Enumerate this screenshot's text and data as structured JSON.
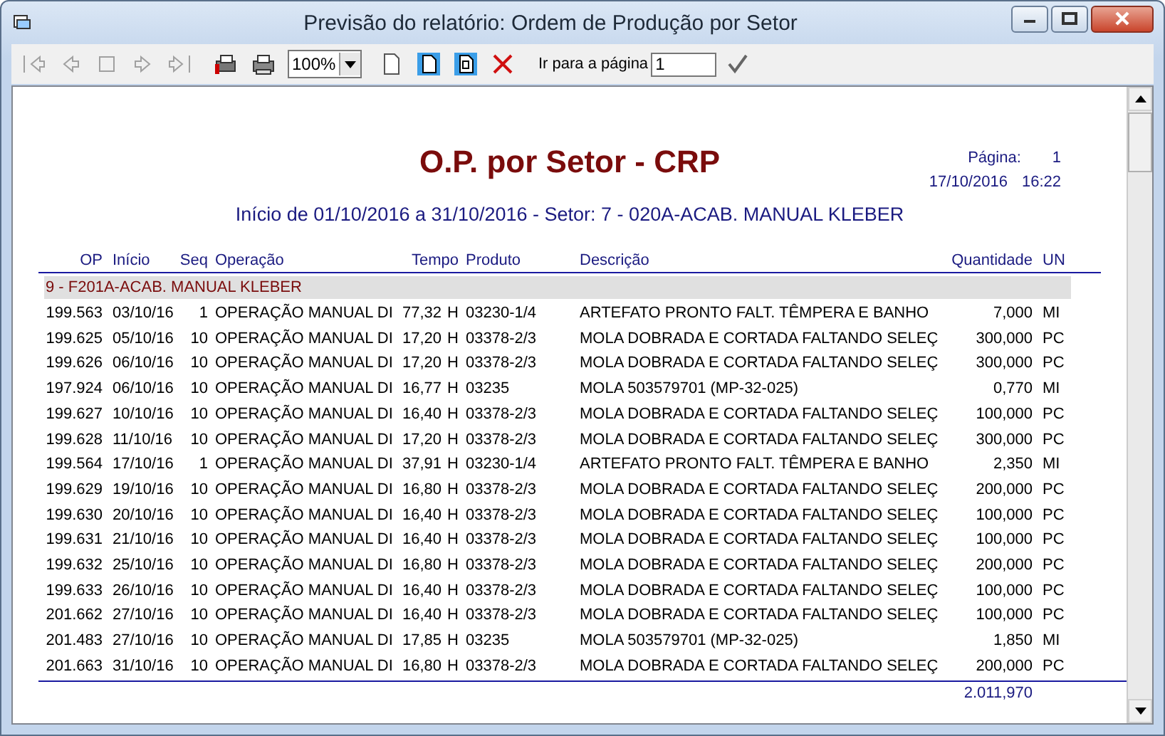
{
  "window": {
    "title": "Previsão do relatório: Ordem de Produção por Setor"
  },
  "toolbar": {
    "buttons": [
      {
        "kind": "first",
        "disabled": true
      },
      {
        "kind": "prev",
        "disabled": true
      },
      {
        "kind": "stop",
        "disabled": true
      },
      {
        "kind": "next",
        "disabled": true
      },
      {
        "kind": "last",
        "disabled": true
      }
    ],
    "print_buttons": [
      {
        "kind": "print-setup"
      },
      {
        "kind": "print"
      }
    ],
    "zoom": {
      "value": "100%"
    },
    "page_buttons": [
      {
        "kind": "page"
      },
      {
        "kind": "page-width"
      },
      {
        "kind": "full-page"
      },
      {
        "kind": "close"
      }
    ],
    "goto": {
      "label": "Ir para a página",
      "value": "1"
    }
  },
  "report": {
    "title": "O.P. por Setor - CRP",
    "subtitle": "Início de 01/10/2016 a 31/10/2016 - Setor: 7 - 020A-ACAB. MANUAL KLEBER",
    "page_label": "Página:",
    "page_number": "1",
    "date": "17/10/2016",
    "time": "16:22",
    "columns": [
      "OP",
      "Início",
      "Seq",
      "Operação",
      "Tempo",
      "",
      "Produto",
      "Descrição",
      "Quantidade",
      "UN"
    ],
    "group": "9 - F201A-ACAB. MANUAL KLEBER",
    "rows": [
      [
        "199.563",
        "03/10/16",
        "1",
        "OPERAÇÃO MANUAL DI",
        "77,32",
        "H",
        "03230-1/4",
        "ARTEFATO PRONTO FALT. TÊMPERA E BANHO",
        "7,000",
        "MI"
      ],
      [
        "199.625",
        "05/10/16",
        "10",
        "OPERAÇÃO MANUAL DI",
        "17,20",
        "H",
        "03378-2/3",
        "MOLA DOBRADA E CORTADA FALTANDO SELEÇ",
        "300,000",
        "PC"
      ],
      [
        "199.626",
        "06/10/16",
        "10",
        "OPERAÇÃO MANUAL DI",
        "17,20",
        "H",
        "03378-2/3",
        "MOLA DOBRADA E CORTADA FALTANDO SELEÇ",
        "300,000",
        "PC"
      ],
      [
        "197.924",
        "06/10/16",
        "10",
        "OPERAÇÃO MANUAL DI",
        "16,77",
        "H",
        "03235",
        "MOLA 503579701 (MP-32-025)",
        "0,770",
        "MI"
      ],
      [
        "199.627",
        "10/10/16",
        "10",
        "OPERAÇÃO MANUAL DI",
        "16,40",
        "H",
        "03378-2/3",
        "MOLA DOBRADA E CORTADA FALTANDO SELEÇ",
        "100,000",
        "PC"
      ],
      [
        "199.628",
        "11/10/16",
        "10",
        "OPERAÇÃO MANUAL DI",
        "17,20",
        "H",
        "03378-2/3",
        "MOLA DOBRADA E CORTADA FALTANDO SELEÇ",
        "300,000",
        "PC"
      ],
      [
        "199.564",
        "17/10/16",
        "1",
        "OPERAÇÃO MANUAL DI",
        "37,91",
        "H",
        "03230-1/4",
        "ARTEFATO PRONTO FALT. TÊMPERA E BANHO",
        "2,350",
        "MI"
      ],
      [
        "199.629",
        "19/10/16",
        "10",
        "OPERAÇÃO MANUAL DI",
        "16,80",
        "H",
        "03378-2/3",
        "MOLA DOBRADA E CORTADA FALTANDO SELEÇ",
        "200,000",
        "PC"
      ],
      [
        "199.630",
        "20/10/16",
        "10",
        "OPERAÇÃO MANUAL DI",
        "16,40",
        "H",
        "03378-2/3",
        "MOLA DOBRADA E CORTADA FALTANDO SELEÇ",
        "100,000",
        "PC"
      ],
      [
        "199.631",
        "21/10/16",
        "10",
        "OPERAÇÃO MANUAL DI",
        "16,40",
        "H",
        "03378-2/3",
        "MOLA DOBRADA E CORTADA FALTANDO SELEÇ",
        "100,000",
        "PC"
      ],
      [
        "199.632",
        "25/10/16",
        "10",
        "OPERAÇÃO MANUAL DI",
        "16,80",
        "H",
        "03378-2/3",
        "MOLA DOBRADA E CORTADA FALTANDO SELEÇ",
        "200,000",
        "PC"
      ],
      [
        "199.633",
        "26/10/16",
        "10",
        "OPERAÇÃO MANUAL DI",
        "16,40",
        "H",
        "03378-2/3",
        "MOLA DOBRADA E CORTADA FALTANDO SELEÇ",
        "100,000",
        "PC"
      ],
      [
        "201.662",
        "27/10/16",
        "10",
        "OPERAÇÃO MANUAL DI",
        "16,40",
        "H",
        "03378-2/3",
        "MOLA DOBRADA E CORTADA FALTANDO SELEÇ",
        "100,000",
        "PC"
      ],
      [
        "201.483",
        "27/10/16",
        "10",
        "OPERAÇÃO MANUAL DI",
        "17,85",
        "H",
        "03235",
        "MOLA 503579701 (MP-32-025)",
        "1,850",
        "MI"
      ],
      [
        "201.663",
        "31/10/16",
        "10",
        "OPERAÇÃO MANUAL DI",
        "16,80",
        "H",
        "03378-2/3",
        "MOLA DOBRADA E CORTADA FALTANDO SELEÇ",
        "200,000",
        "PC"
      ]
    ],
    "total": "2.011,970"
  }
}
